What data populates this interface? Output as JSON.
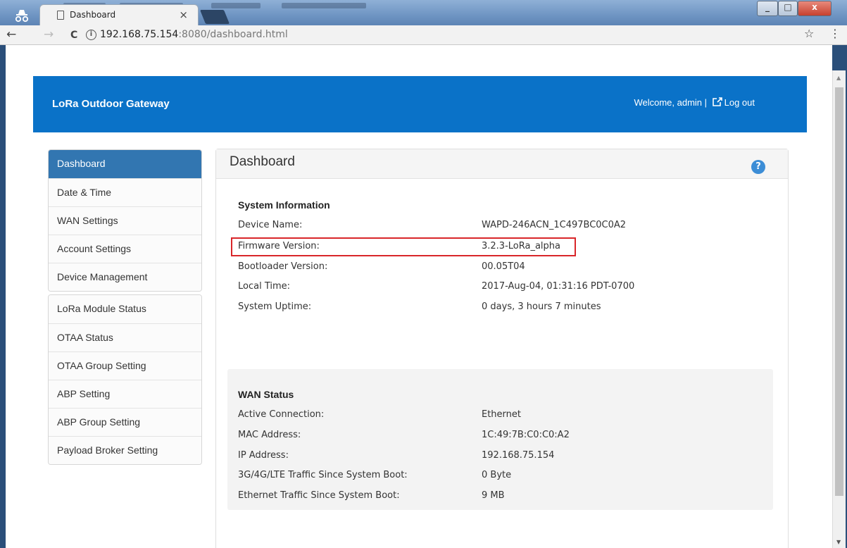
{
  "browser": {
    "tab_title": "Dashboard",
    "tab_close": "×",
    "url_host": "192.168.75.154",
    "url_rest": ":8080/dashboard.html",
    "url_info_glyph": "i",
    "nav": {
      "back": "←",
      "forward": "→",
      "reload": "C"
    },
    "star": "☆",
    "menu": "⋮",
    "window_controls": {
      "minimize": "_",
      "maximize": "□",
      "close": "x"
    }
  },
  "header": {
    "brand": "LoRa Outdoor Gateway",
    "welcome": "Welcome, admin |",
    "logout": "Log out"
  },
  "sidebar": {
    "group1": [
      {
        "label": "Dashboard",
        "active": true
      },
      {
        "label": "Date & Time"
      },
      {
        "label": "WAN Settings"
      },
      {
        "label": "Account Settings"
      },
      {
        "label": "Device Management"
      }
    ],
    "group2": [
      {
        "label": "LoRa Module Status"
      },
      {
        "label": "OTAA Status"
      },
      {
        "label": "OTAA Group Setting"
      },
      {
        "label": "ABP Setting"
      },
      {
        "label": "ABP Group Setting"
      },
      {
        "label": "Payload Broker Setting"
      }
    ]
  },
  "main": {
    "title": "Dashboard",
    "help": "?",
    "system_info": {
      "title": "System Information",
      "rows": [
        {
          "label": "Device Name:",
          "value": "WAPD-246ACN_1C497BC0C0A2"
        },
        {
          "label": "Firmware Version:",
          "value": "3.2.3-LoRa_alpha"
        },
        {
          "label": "Bootloader Version:",
          "value": "00.05T04"
        },
        {
          "label": "Local Time:",
          "value": "2017-Aug-04, 01:31:16 PDT-0700"
        },
        {
          "label": "System Uptime:",
          "value": "0 days, 3 hours 7 minutes"
        }
      ]
    },
    "wan_status": {
      "title": "WAN Status",
      "rows": [
        {
          "label": "Active Connection:",
          "value": "Ethernet"
        },
        {
          "label": "MAC Address:",
          "value": "1C:49:7B:C0:C0:A2"
        },
        {
          "label": "IP Address:",
          "value": "192.168.75.154"
        },
        {
          "label": "3G/4G/LTE Traffic Since System Boot:",
          "value": "0 Byte"
        },
        {
          "label": "Ethernet Traffic Since System Boot:",
          "value": "9 MB"
        }
      ]
    }
  },
  "colors": {
    "header_blue": "#0a72c8",
    "active_nav": "#3276b1",
    "highlight_red": "#d9262a"
  }
}
